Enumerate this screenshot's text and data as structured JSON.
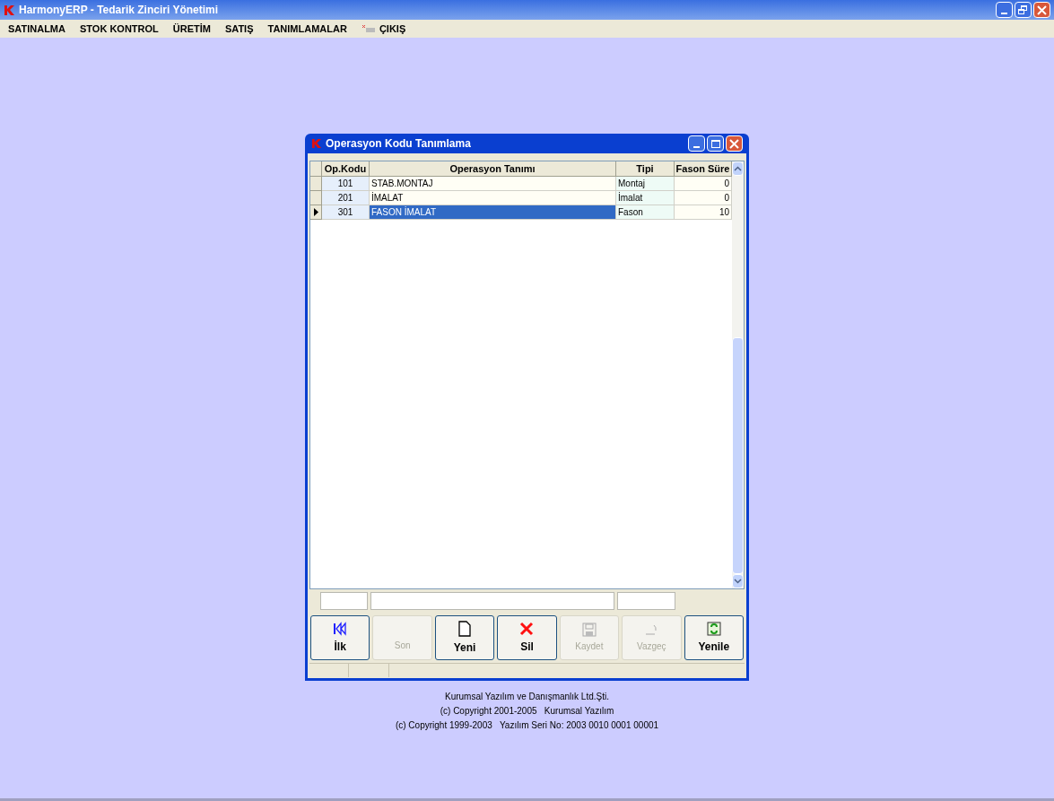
{
  "window": {
    "title": "HarmonyERP - Tedarik Zinciri Yönetimi"
  },
  "menu": [
    {
      "label": "SATINALMA",
      "kind": "text"
    },
    {
      "label": "STOK KONTROL",
      "kind": "text"
    },
    {
      "label": "ÜRETİM",
      "kind": "text"
    },
    {
      "label": "SATIŞ",
      "kind": "text"
    },
    {
      "label": "TANIMLAMALAR",
      "kind": "text"
    },
    {
      "label": "ÇIKIŞ",
      "kind": "exit"
    }
  ],
  "dialog": {
    "title": "Operasyon Kodu Tanımlama",
    "table": {
      "columns": [
        "Op.Kodu",
        "Operasyon Tanımı",
        "Tipi",
        "Fason Süre"
      ],
      "rows": [
        {
          "cells": [
            "101",
            "STAB.MONTAJ",
            "Montaj",
            "0"
          ],
          "selected": false
        },
        {
          "cells": [
            "201",
            "İMALAT",
            "İmalat",
            "0"
          ],
          "selected": false
        },
        {
          "cells": [
            "301",
            "FASON İMALAT",
            "Fason",
            "10"
          ],
          "selected": true
        }
      ]
    },
    "buttons": [
      {
        "label": "İlk",
        "kind": "first",
        "disabled": false
      },
      {
        "label": "Son",
        "kind": "last",
        "disabled": true
      },
      {
        "label": "Yeni",
        "kind": "new",
        "disabled": false
      },
      {
        "label": "Sil",
        "kind": "delete",
        "disabled": false
      },
      {
        "label": "Kaydet",
        "kind": "save",
        "disabled": true
      },
      {
        "label": "Vazgeç",
        "kind": "cancel",
        "disabled": true
      },
      {
        "label": "Yenile",
        "kind": "refresh",
        "disabled": false
      }
    ]
  },
  "footer": [
    "Kurumsal Yazılım ve Danışmanlık Ltd.Şti.",
    "(c) Copyright 2001-2005   Kurumsal Yazılım",
    "(c) Copyright 1999-2003   Yazılım Seri No: 2003 0010 0001 00001"
  ]
}
